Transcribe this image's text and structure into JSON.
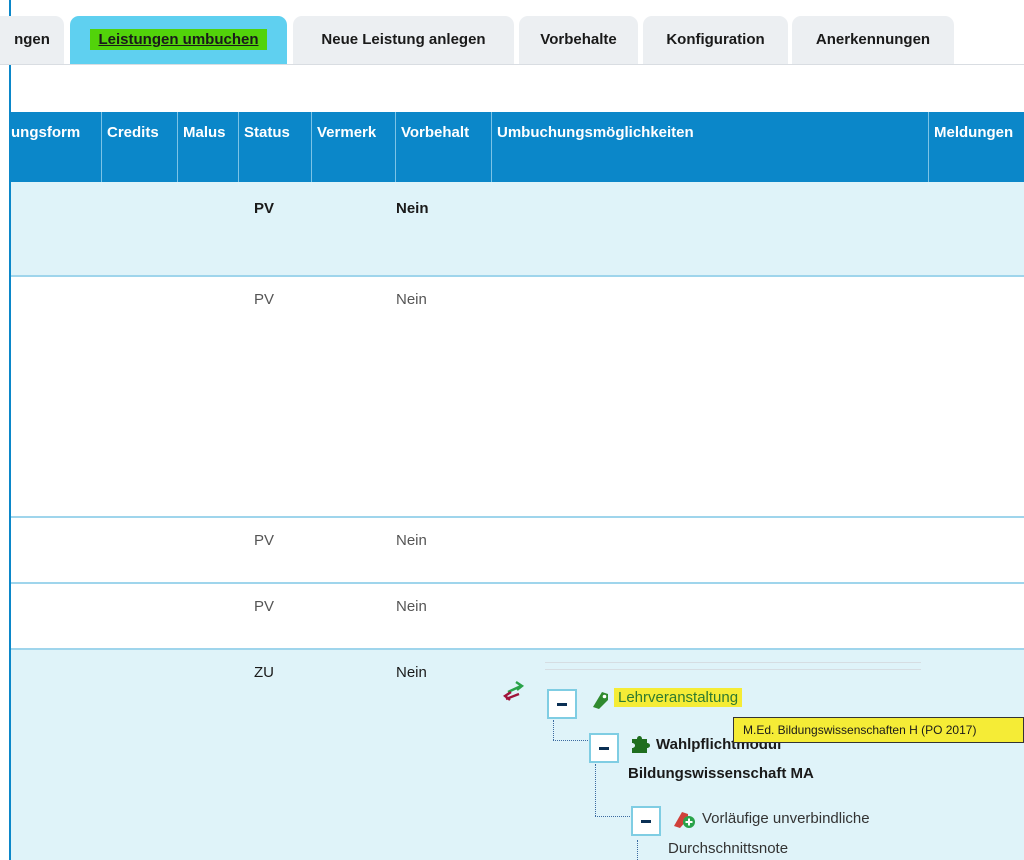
{
  "tabs": [
    {
      "label": "ngen"
    },
    {
      "label": "Leistungen umbuchen",
      "active": true
    },
    {
      "label": "Neue Leistung anlegen"
    },
    {
      "label": "Vorbehalte"
    },
    {
      "label": "Konfiguration"
    },
    {
      "label": "Anerkennungen"
    }
  ],
  "table": {
    "headers": {
      "form": "ungsform",
      "credits": "Credits",
      "malus": "Malus",
      "status": "Status",
      "vermerk": "Vermerk",
      "vorbehalt": "Vorbehalt",
      "umbuchung": "Umbuchungsmöglichkeiten",
      "meldungen": "Meldungen"
    },
    "rows": [
      {
        "status": "PV",
        "vorbehalt": "Nein"
      },
      {
        "status": "PV",
        "vorbehalt": "Nein"
      },
      {
        "status": "PV",
        "vorbehalt": "Nein"
      },
      {
        "status": "PV",
        "vorbehalt": "Nein"
      },
      {
        "status": "ZU",
        "vorbehalt": "Nein"
      }
    ]
  },
  "tree": {
    "node1": "Lehrveranstaltung",
    "node2_line1": "Wahlpflichtmodul",
    "node2_line2": "Bildungswissenschaft MA",
    "node3_line1": "Vorläufige unverbindliche",
    "node3_line2": "Durchschnittsnote"
  },
  "tooltip": "M.Ed. Bildungswissenschaften H (PO 2017)",
  "colors": {
    "header_bg": "#0b87c9",
    "active_tab": "#5fd0f0",
    "highlight_green": "#52d30a",
    "highlight_yellow": "#f5ec36",
    "row_highlight": "#dff3f9"
  }
}
